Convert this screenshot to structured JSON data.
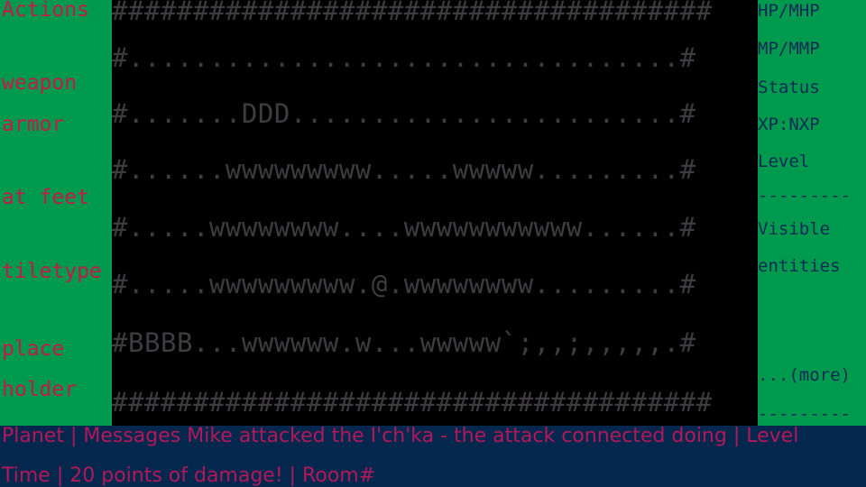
{
  "left_panel": {
    "actions": "Actions",
    "weapon": "weapon",
    "armor": "armor",
    "at_feet": "at feet",
    "tiletype": "tiletype",
    "place": "place",
    "holder": "holder"
  },
  "map": {
    "rows": [
      "#####################################",
      "#..................................#",
      "#.......DDD........................#",
      "#......wwwwwwwww.....wwwww.........#",
      "#.....wwwwwwww....wwwwwwwwwww......#",
      "#.....wwwwwwwww.@.wwwwwwww.........#",
      "#BBBB...wwwwww.w...wwwww`;,,;,,,,,.#",
      "#####################################"
    ]
  },
  "right_panel": {
    "hp": "HP/MHP",
    "mp": "MP/MMP",
    "status": "Status",
    "xp": "XP:NXP",
    "level": "Level",
    "divider": "---------",
    "visible": "Visible",
    "entities": "entities",
    "more": "...(more)",
    "divider_bottom": "---------"
  },
  "messages": {
    "line1": "Planet | Messages Mike attacked the I'ch'ka - the attack connected doing | Level",
    "line2": "Time | 20 points of damage! | Room#"
  },
  "colors": {
    "panel_green": "#009a4e",
    "map_black": "#000000",
    "map_glyph": "#3f3c3f",
    "left_text": "#c41a4a",
    "right_text": "#0a2a55",
    "message_bg": "#04274e",
    "message_text": "#b3185a"
  }
}
